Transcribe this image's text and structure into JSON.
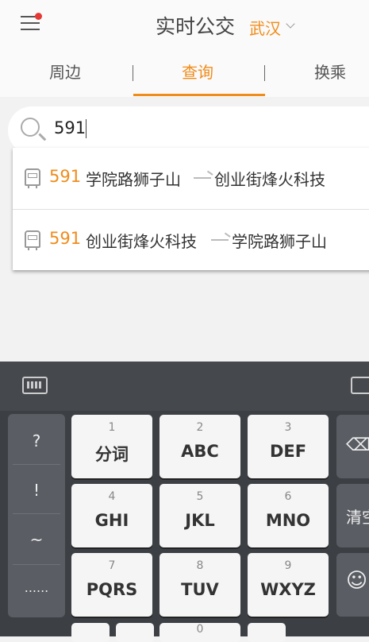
{
  "header": {
    "title": "实时公交",
    "city": "武汉"
  },
  "tabs": [
    {
      "label": "周边"
    },
    {
      "label": "查询"
    },
    {
      "label": "换乘"
    }
  ],
  "search": {
    "value": "591"
  },
  "suggestions": [
    {
      "route": "591",
      "from": "学院路狮子山",
      "to": "创业街烽火科技"
    },
    {
      "route": "591",
      "from": "创业街烽火科技",
      "to": "学院路狮子山"
    }
  ],
  "keyboard": {
    "symbols": [
      "?",
      "!",
      "~",
      "......"
    ],
    "keys": [
      {
        "num": "1",
        "label": "分词"
      },
      {
        "num": "2",
        "label": "ABC"
      },
      {
        "num": "3",
        "label": "DEF"
      },
      {
        "num": "4",
        "label": "GHI"
      },
      {
        "num": "5",
        "label": "JKL"
      },
      {
        "num": "6",
        "label": "MNO"
      },
      {
        "num": "7",
        "label": "PQRS"
      },
      {
        "num": "8",
        "label": "TUV"
      },
      {
        "num": "9",
        "label": "WXYZ"
      }
    ],
    "clear_label": "清空",
    "zero_label": "0",
    "accent": "#f08c1a"
  }
}
